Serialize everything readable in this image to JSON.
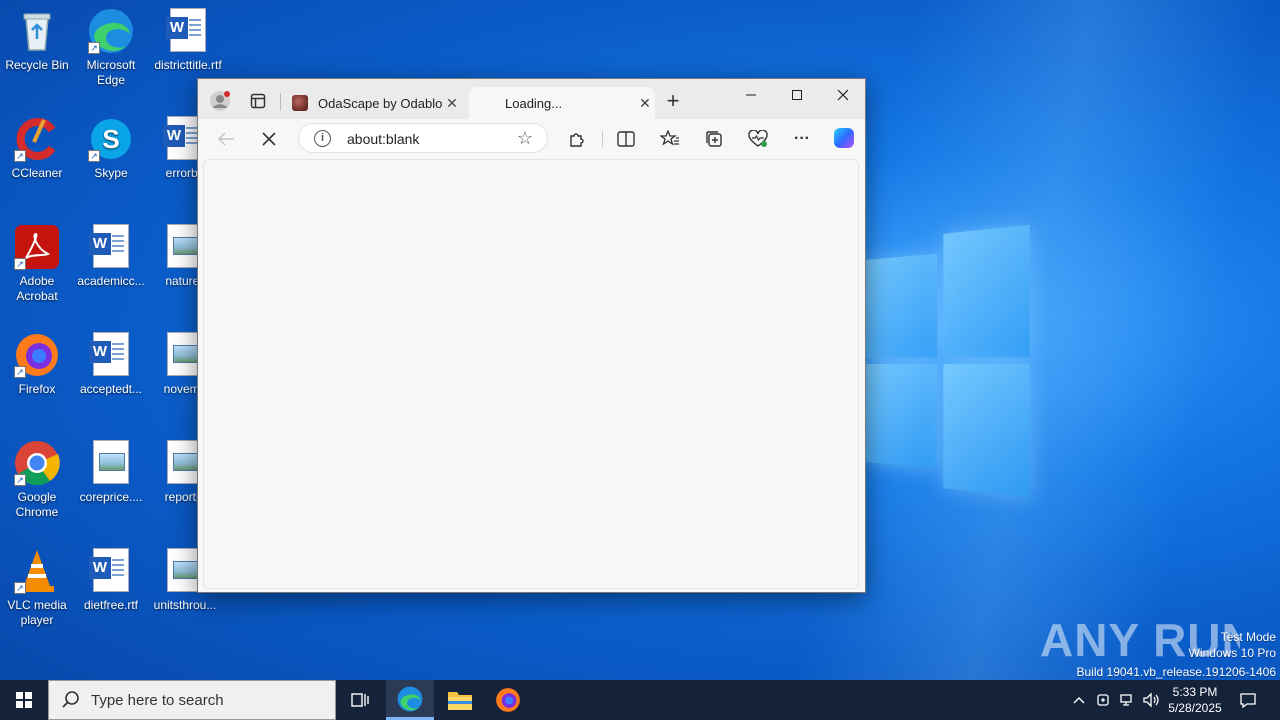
{
  "desktop": {
    "icons": [
      {
        "label": "Recycle Bin"
      },
      {
        "label": "Microsoft Edge"
      },
      {
        "label": "districttitle.rtf"
      },
      {
        "label": "CCleaner"
      },
      {
        "label": "Skype"
      },
      {
        "label": "errorbo"
      },
      {
        "label": "Adobe Acrobat"
      },
      {
        "label": "academicc..."
      },
      {
        "label": "natureli"
      },
      {
        "label": "Firefox"
      },
      {
        "label": "acceptedt..."
      },
      {
        "label": "novemb"
      },
      {
        "label": "Google Chrome"
      },
      {
        "label": "coreprice...."
      },
      {
        "label": "reportpl"
      },
      {
        "label": "VLC media player"
      },
      {
        "label": "dietfree.rtf"
      },
      {
        "label": "unitsthrou..."
      }
    ]
  },
  "browser": {
    "tabs": [
      {
        "label": "OdaScape by Odablock",
        "close": "✕"
      },
      {
        "label": "Loading...",
        "close": "✕"
      }
    ],
    "new_tab": "+",
    "address": {
      "url": "about:blank"
    },
    "icons": [
      "profile-icon",
      "tab-actions-icon",
      "back-icon",
      "stop-icon",
      "info-icon",
      "favorite-star-icon",
      "extensions-icon",
      "split-screen-icon",
      "favorites-icon",
      "collections-icon",
      "browser-essentials-icon",
      "more-icon",
      "copilot-icon"
    ]
  },
  "watermark": {
    "logo": "ANY RUN",
    "line1": "Test Mode",
    "line2": "Windows 10 Pro",
    "line3": "Build 19041.vb_release.191206-1406"
  },
  "taskbar": {
    "search_placeholder": "Type here to search",
    "time": "5:33 PM",
    "date": "5/28/2025"
  }
}
